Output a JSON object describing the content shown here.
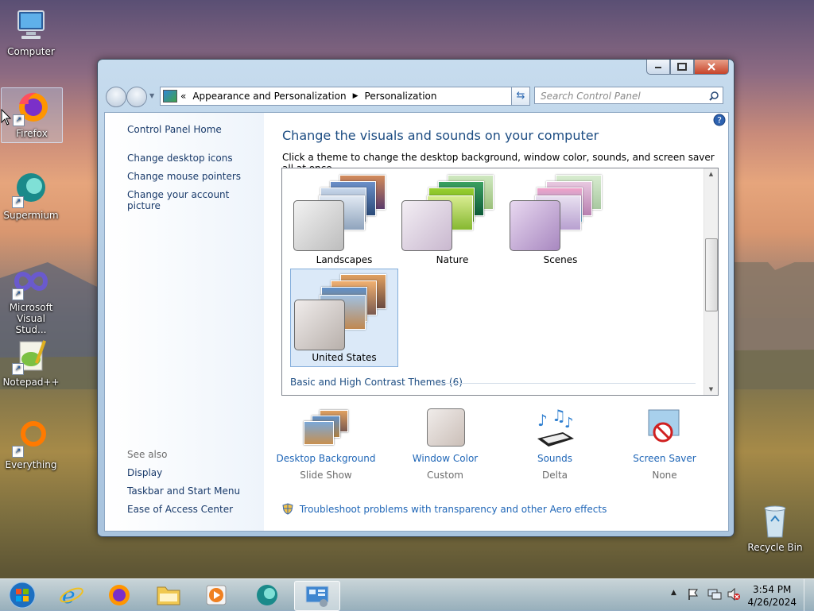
{
  "desktop": {
    "icons": [
      {
        "label": "Computer"
      },
      {
        "label": "Firefox"
      },
      {
        "label": "Supermium"
      },
      {
        "label_line1": "Microsoft",
        "label_line2": "Visual Stud..."
      },
      {
        "label": "Notepad++"
      },
      {
        "label": "Everything"
      },
      {
        "label": "Recycle Bin"
      }
    ]
  },
  "window": {
    "address": {
      "prefix": "«",
      "crumbs": [
        "Appearance and Personalization",
        "Personalization"
      ]
    },
    "search_placeholder": "Search Control Panel",
    "sidebar": {
      "home": "Control Panel Home",
      "links": [
        "Change desktop icons",
        "Change mouse pointers",
        "Change your account picture"
      ],
      "see_also_title": "See also",
      "see_also": [
        "Display",
        "Taskbar and Start Menu",
        "Ease of Access Center"
      ]
    },
    "main": {
      "title": "Change the visuals and sounds on your computer",
      "subtitle": "Click a theme to change the desktop background, window color, sounds, and screen saver all at once.",
      "themes": [
        {
          "name": "Landscapes",
          "selected": false
        },
        {
          "name": "Nature",
          "selected": false
        },
        {
          "name": "Scenes",
          "selected": false
        },
        {
          "name": "United States",
          "selected": true
        }
      ],
      "basic_section": "Basic and High Contrast Themes (6)",
      "settings": [
        {
          "title": "Desktop Background",
          "value": "Slide Show"
        },
        {
          "title": "Window Color",
          "value": "Custom"
        },
        {
          "title": "Sounds",
          "value": "Delta"
        },
        {
          "title": "Screen Saver",
          "value": "None"
        }
      ],
      "troubleshoot": "Troubleshoot problems with transparency and other Aero effects"
    }
  },
  "taskbar": {
    "time": "3:54 PM",
    "date": "4/26/2024"
  },
  "colors": {
    "link": "#1f66b7",
    "heading": "#1c4c82",
    "selected_theme_bg": "#dbe9f8"
  }
}
